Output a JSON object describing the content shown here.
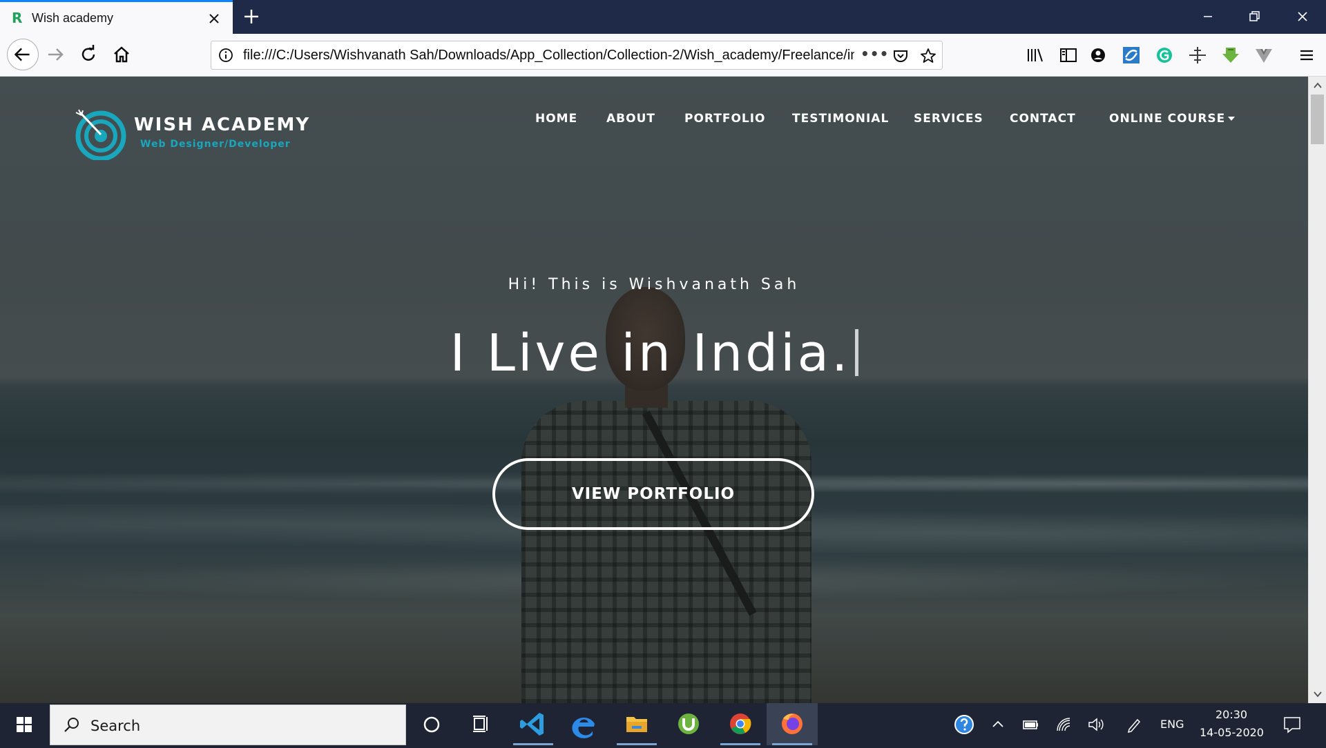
{
  "browser": {
    "tab": {
      "title": "Wish academy",
      "favicon": "R"
    },
    "url": "file:///C:/Users/Wishvanath Sah/Downloads/App_Collection/Collection-2/Wish_academy/Freelance/index.html",
    "url_more": "•••"
  },
  "site": {
    "brand": {
      "name": "WISH ACADEMY",
      "tagline": "Web Designer/Developer"
    },
    "nav": [
      "HOME",
      "ABOUT",
      "PORTFOLIO",
      "TESTIMONIAL",
      "SERVICES",
      "CONTACT",
      "ONLINE COURSE"
    ],
    "hero": {
      "subtitle": "Hi! This is Wishvanath Sah",
      "title": "I Live in India.",
      "button": "VIEW PORTFOLIO"
    }
  },
  "taskbar": {
    "search_placeholder": "Search",
    "language": "ENG",
    "time": "20:30",
    "date": "14-05-2020"
  },
  "colors": {
    "accent": "#19a7bd",
    "tab_indicator": "#0a84ff",
    "titlebar": "#1f2a48",
    "taskbar": "#1e2433"
  }
}
